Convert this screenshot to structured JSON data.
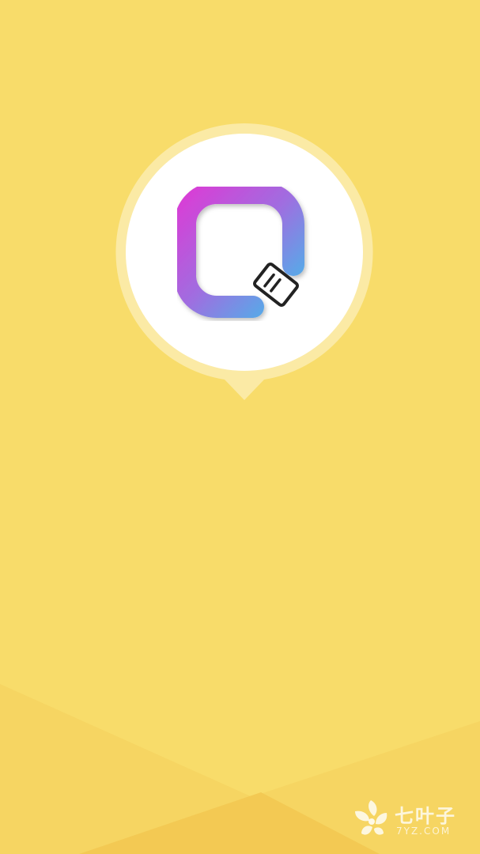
{
  "app": {
    "logo_icon": "app-logo-icon",
    "badge_icon": "book-icon"
  },
  "colors": {
    "background": "#f8dc6a",
    "background_shape_light": "#f6d562",
    "background_shape_dark": "#f3c953",
    "bubble_ring": "#fbeaa5",
    "bubble_fill": "#ffffff",
    "logo_gradient_start": "#d93ed6",
    "logo_gradient_mid": "#9f6ee0",
    "logo_gradient_end": "#46b8ea"
  },
  "watermark": {
    "title": "七叶子",
    "domain": "7YZ.COM",
    "icon": "leaf-logo-icon"
  }
}
